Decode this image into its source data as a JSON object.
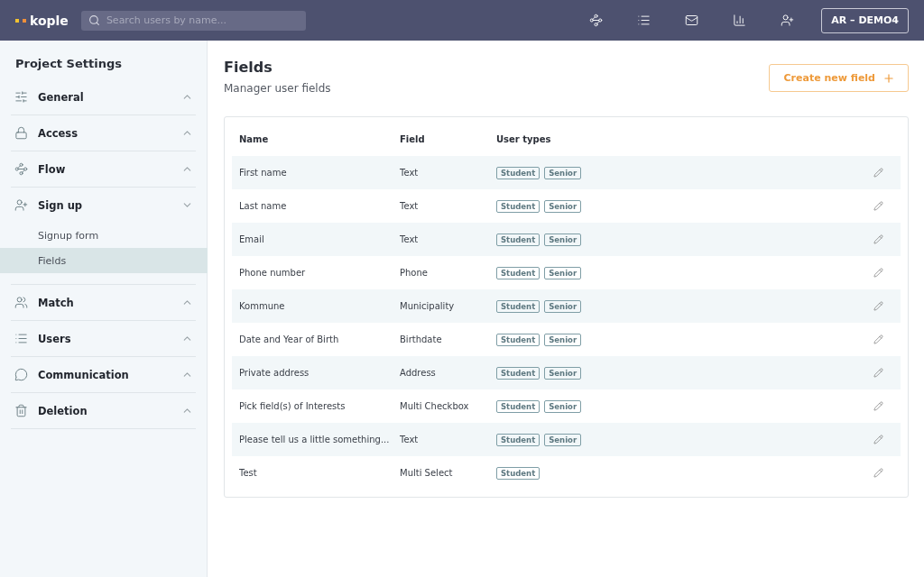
{
  "topbar": {
    "logo": "kople",
    "search": {
      "placeholder": "Search users by name..."
    },
    "account": "AR – DEMO4"
  },
  "sidebar": {
    "title": "Project Settings",
    "items": [
      {
        "label": "General",
        "expanded": false
      },
      {
        "label": "Access",
        "expanded": false
      },
      {
        "label": "Flow",
        "expanded": false
      },
      {
        "label": "Sign up",
        "expanded": true,
        "children": [
          {
            "label": "Signup form",
            "selected": false
          },
          {
            "label": "Fields",
            "selected": true
          }
        ]
      },
      {
        "label": "Match",
        "expanded": false
      },
      {
        "label": "Users",
        "expanded": false
      },
      {
        "label": "Communication",
        "expanded": false
      },
      {
        "label": "Deletion",
        "expanded": false
      }
    ]
  },
  "page": {
    "title": "Fields",
    "subtitle": "Manager user fields",
    "create_button": "Create new field"
  },
  "table": {
    "columns": [
      "Name",
      "Field",
      "User types"
    ],
    "rows": [
      {
        "name": "First name",
        "field": "Text",
        "types": [
          "Student",
          "Senior"
        ]
      },
      {
        "name": "Last name",
        "field": "Text",
        "types": [
          "Student",
          "Senior"
        ]
      },
      {
        "name": "Email",
        "field": "Text",
        "types": [
          "Student",
          "Senior"
        ]
      },
      {
        "name": "Phone number",
        "field": "Phone",
        "types": [
          "Student",
          "Senior"
        ]
      },
      {
        "name": "Kommune",
        "field": "Municipality",
        "types": [
          "Student",
          "Senior"
        ]
      },
      {
        "name": "Date and Year of Birth",
        "field": "Birthdate",
        "types": [
          "Student",
          "Senior"
        ]
      },
      {
        "name": "Private address",
        "field": "Address",
        "types": [
          "Student",
          "Senior"
        ]
      },
      {
        "name": "Pick field(s) of Interests",
        "field": "Multi Checkbox",
        "types": [
          "Student",
          "Senior"
        ]
      },
      {
        "name": "Please tell us a little something...",
        "field": "Text",
        "types": [
          "Student",
          "Senior"
        ]
      },
      {
        "name": "Test",
        "field": "Multi Select",
        "types": [
          "Student"
        ]
      }
    ]
  }
}
